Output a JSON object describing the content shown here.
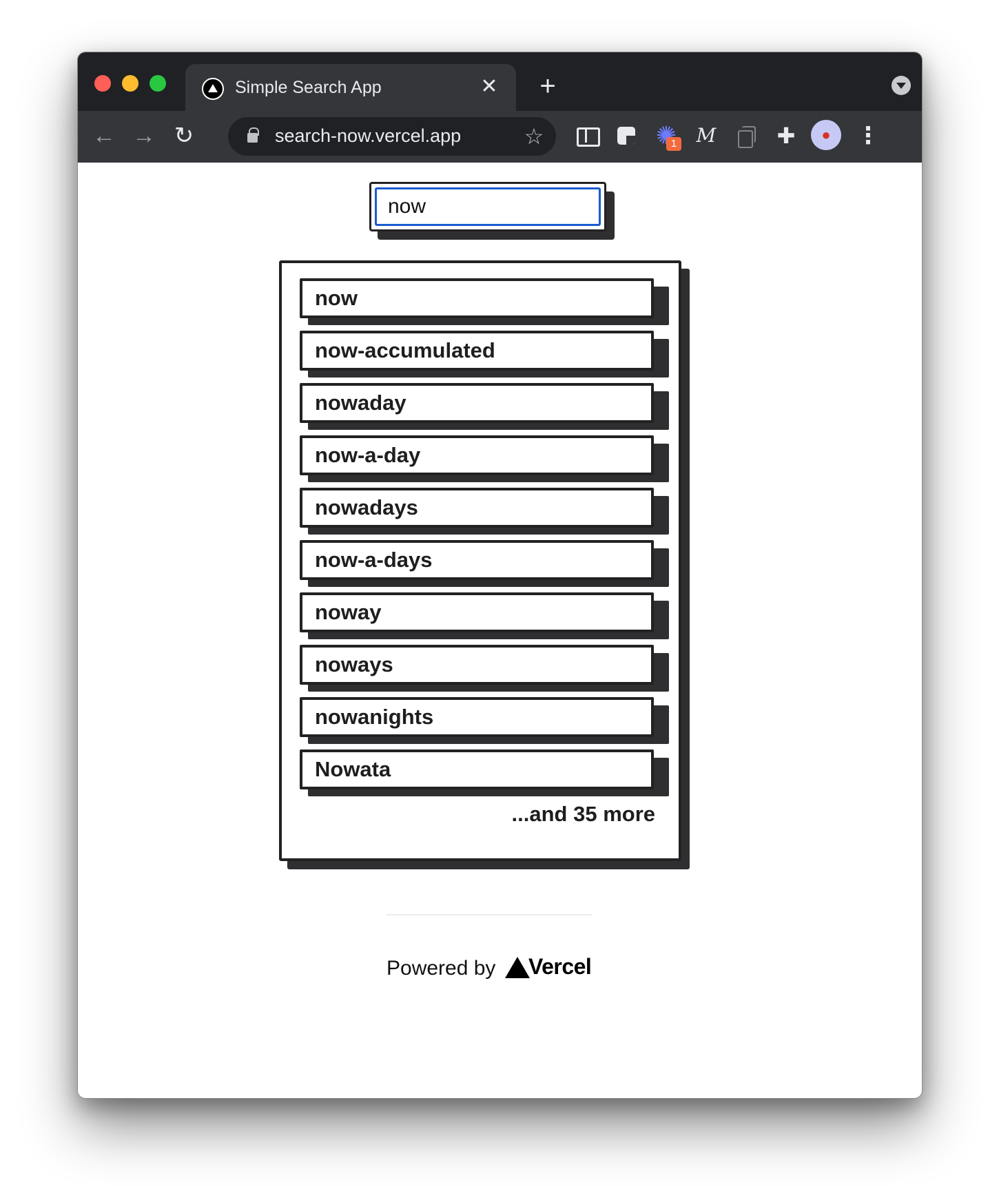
{
  "browser": {
    "tab": {
      "title": "Simple Search App",
      "favicon": "vercel-triangle-icon",
      "close_glyph": "✕"
    },
    "new_tab_glyph": "+",
    "toolbar": {
      "back_glyph": "←",
      "forward_glyph": "→",
      "reload_glyph": "↻",
      "url": "search-now.vercel.app",
      "bookmark_glyph": "☆",
      "extension_badge": "1",
      "extension_m_glyph": "M",
      "menu_glyph": "⋮"
    }
  },
  "search": {
    "value": "now",
    "placeholder": ""
  },
  "results": {
    "items": [
      "now",
      "now-accumulated",
      "nowaday",
      "now-a-day",
      "nowadays",
      "now-a-days",
      "noway",
      "noways",
      "nowanights",
      "Nowata"
    ],
    "more_text": "...and 35 more"
  },
  "footer": {
    "powered_by": "Powered by",
    "brand": "Vercel"
  },
  "colors": {
    "focus_ring": "#1a5ccf",
    "card_border": "#222222",
    "card_shadow": "#2f2f31",
    "chrome_dark": "#202124",
    "chrome_toolbar": "#35363a"
  }
}
